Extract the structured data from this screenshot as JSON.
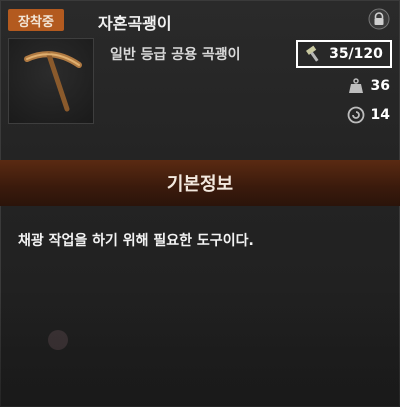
{
  "header": {
    "badge_label": "장착중",
    "item_name": "자혼곡괭이",
    "lock_icon": "lock-icon"
  },
  "item": {
    "grade_text": "일반 등급 공용 곡괭이",
    "thumbnail_icon": "pickaxe-icon"
  },
  "stats": {
    "durability": "35/120",
    "durability_icon": "hammer-icon",
    "weight": "36",
    "weight_icon": "weight-icon",
    "level": "14",
    "level_icon": "level-icon"
  },
  "section": {
    "title": "기본정보",
    "description": "채광 작업을 하기 위해 필요한 도구이다."
  },
  "colors": {
    "badge": "#b35a1f",
    "section_bar": "#4a2010",
    "highlight_border": "#ffffff"
  }
}
